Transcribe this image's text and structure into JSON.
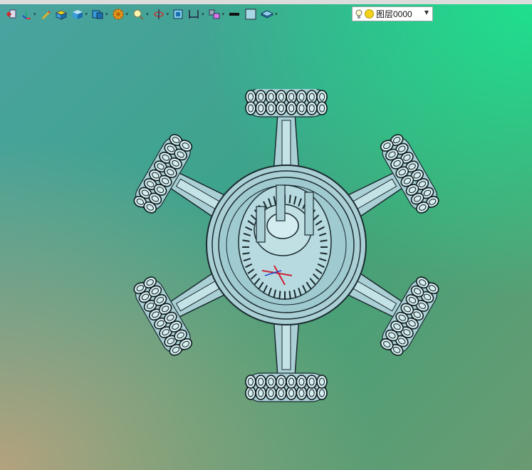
{
  "toolbar": {
    "icons": [
      "exit-icon",
      "axis-icon",
      "pencil-icon",
      "box-icon",
      "cube-icon",
      "view-cube-icon",
      "render-icon",
      "zoom-icon",
      "rotate-icon",
      "frame-icon",
      "dimension-icon",
      "transform-icon",
      "line-color-icon",
      "fill-color-icon",
      "layers-icon"
    ],
    "colors": {
      "line": "#111111",
      "fill": "#a8d8e6",
      "accent_yellow": "#f2d21b"
    }
  },
  "layer": {
    "name": "图层0000",
    "bulb_icon": "bulb-icon",
    "state_icon": "sun-icon"
  },
  "viewport": {
    "bg_colors": [
      "#1ee08e",
      "#4aa3a0",
      "#b4a27e"
    ],
    "model_fill": "#aad0d6",
    "model_stroke": "#1a2a2e"
  }
}
